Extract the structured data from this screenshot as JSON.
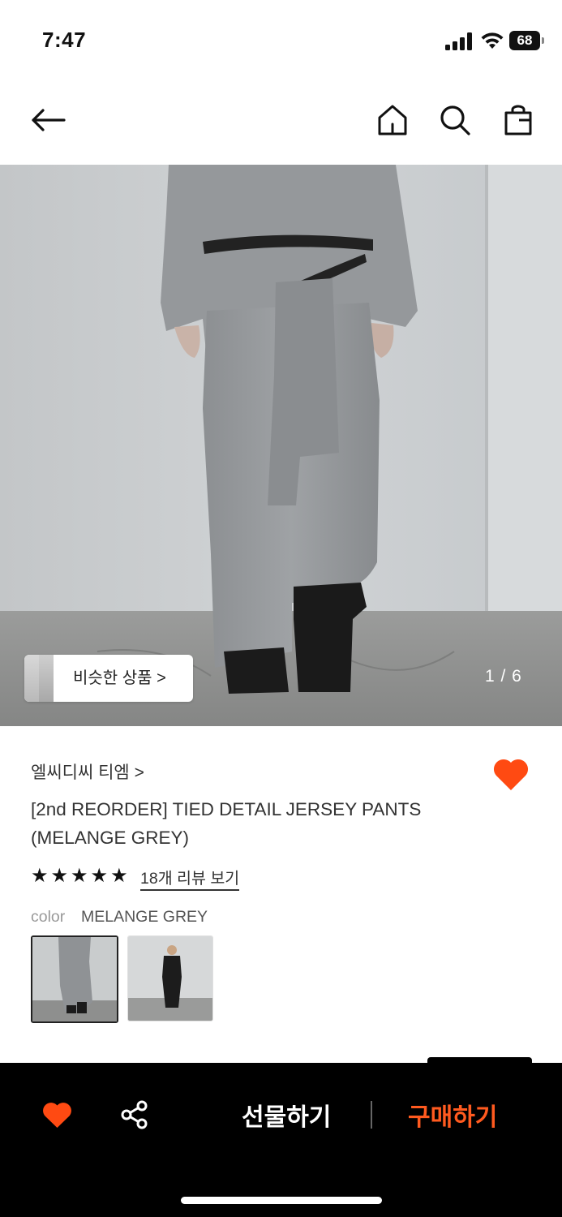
{
  "status_bar": {
    "time": "7:47",
    "battery": "68"
  },
  "header": {
    "icons": [
      "back-arrow-icon",
      "home-icon",
      "search-icon",
      "shopping-bag-icon"
    ]
  },
  "gallery": {
    "similar_label": "비슷한 상품 >",
    "page_indicator": "1 / 6"
  },
  "product": {
    "brand": "엘씨디씨 티엠 >",
    "title": "[2nd REORDER] TIED DETAIL JERSEY PANTS (MELANGE GREY)",
    "rating_stars": 5,
    "review_link": "18개 리뷰 보기",
    "color_label": "color",
    "color_value": "MELANGE GREY"
  },
  "bottom_bar": {
    "gift_label": "선물하기",
    "buy_label": "구매하기"
  },
  "colors": {
    "accent": "#ff5a1f",
    "wishlist": "#ff4a12",
    "bar": "#000000"
  }
}
